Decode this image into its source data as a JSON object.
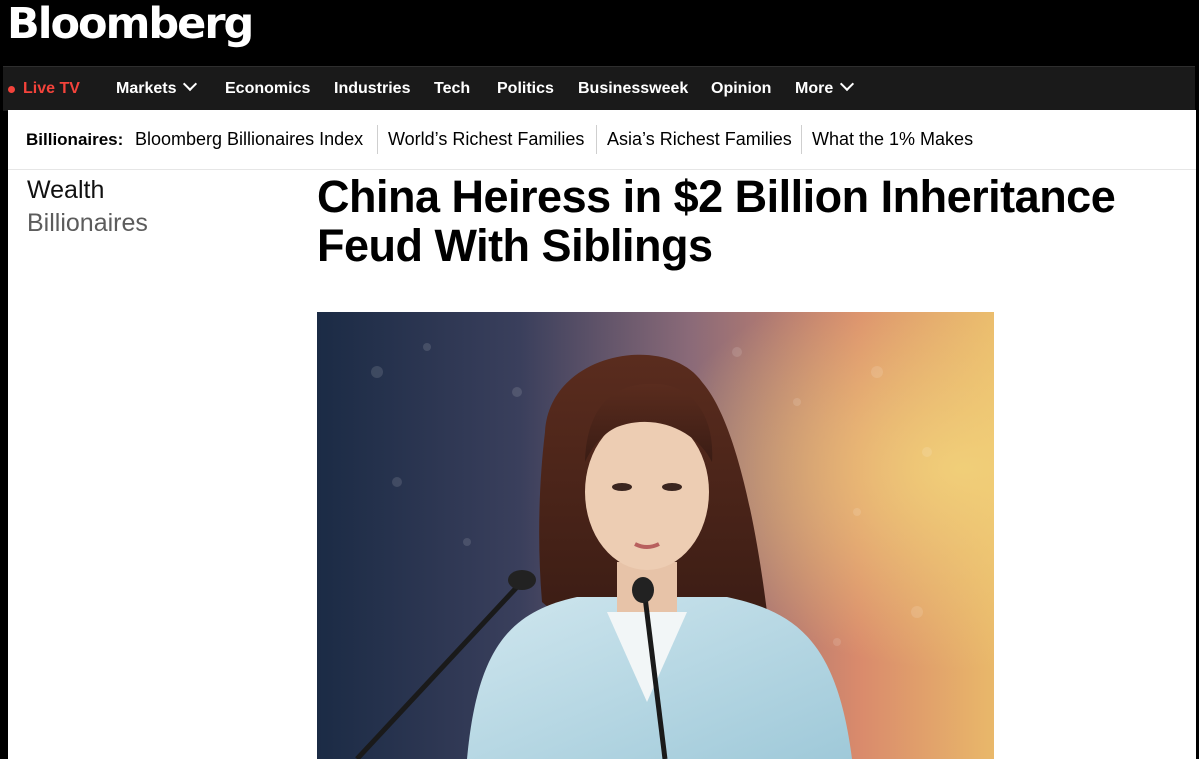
{
  "brand": {
    "logo": "Bloomberg"
  },
  "nav": {
    "live_label": "Live TV",
    "items": [
      {
        "label": "Markets",
        "has_dropdown": true
      },
      {
        "label": "Economics",
        "has_dropdown": false
      },
      {
        "label": "Industries",
        "has_dropdown": false
      },
      {
        "label": "Tech",
        "has_dropdown": false
      },
      {
        "label": "Politics",
        "has_dropdown": false
      },
      {
        "label": "Businessweek",
        "has_dropdown": false
      },
      {
        "label": "Opinion",
        "has_dropdown": false
      },
      {
        "label": "More",
        "has_dropdown": true
      }
    ]
  },
  "subnav": {
    "title": "Billionaires:",
    "links": [
      "Bloomberg Billionaires Index",
      "World’s Richest Families",
      "Asia’s Richest Families",
      "What the 1% Makes"
    ]
  },
  "article": {
    "section": "Wealth",
    "subsection": "Billionaires",
    "headline": "China Heiress in $2 Billion Inheritance Feud With Siblings"
  },
  "colors": {
    "live_accent": "#f4433b",
    "nav_background": "#1a1a1a",
    "page_background": "#ffffff"
  }
}
